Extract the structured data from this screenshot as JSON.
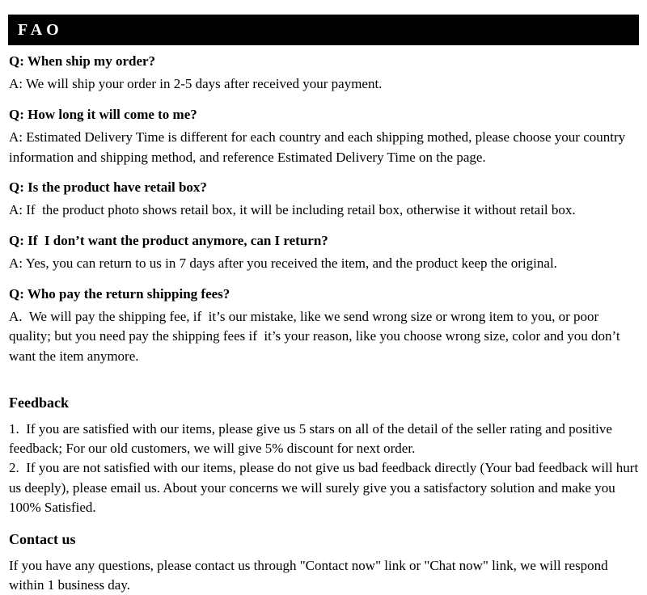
{
  "header": {
    "title": "FAQ",
    "display_title": "FAO",
    "background_color": "#000000",
    "text_color": "#ffffff"
  },
  "faq": {
    "items": [
      {
        "question": "Q: When ship my order?",
        "answer": "A: We will ship your order in 2-5 days after received your payment."
      },
      {
        "question": "Q: How long it will come to me?",
        "answer": "A: Estimated Delivery Time is different for each country and each shipping mothed, please choose your country information and shipping method, and reference Estimated Delivery Time on the page."
      },
      {
        "question": "Q: Is the product have retail box?",
        "answer": "A: If  the product photo shows retail box, it will be including retail box, otherwise it without retail box."
      },
      {
        "question": "Q: If  I don’t want the product anymore, can I return?",
        "answer": "A: Yes, you can return to us in 7 days after you received the item, and the product keep the original."
      },
      {
        "question": "Q: Who pay the return shipping fees?",
        "answer": "A.  We will pay the shipping fee, if  it’s our mistake, like we send wrong size or wrong item to you, or poor quality; but you need pay the shipping fees if  it’s your reason, like you choose wrong size, color and you don’t want the item anymore."
      }
    ]
  },
  "feedback": {
    "heading": "Feedback",
    "lines": [
      "1.  If you are satisfied with our items, please give us 5 stars on all of the detail of the seller rating and positive feedback; For our old customers, we will give 5% discount for next order.",
      "2.  If you are not satisfied with our items, please do not give us bad feedback directly (Your bad feedback will hurt us deeply), please email us. About your concerns we will surely give you a satisfactory solution and make you 100% Satisfied."
    ]
  },
  "contact": {
    "heading": "Contact us",
    "body": "If you have any questions, please contact us through \"Contact now\" link or \"Chat now\" link, we will respond within 1 business day."
  }
}
